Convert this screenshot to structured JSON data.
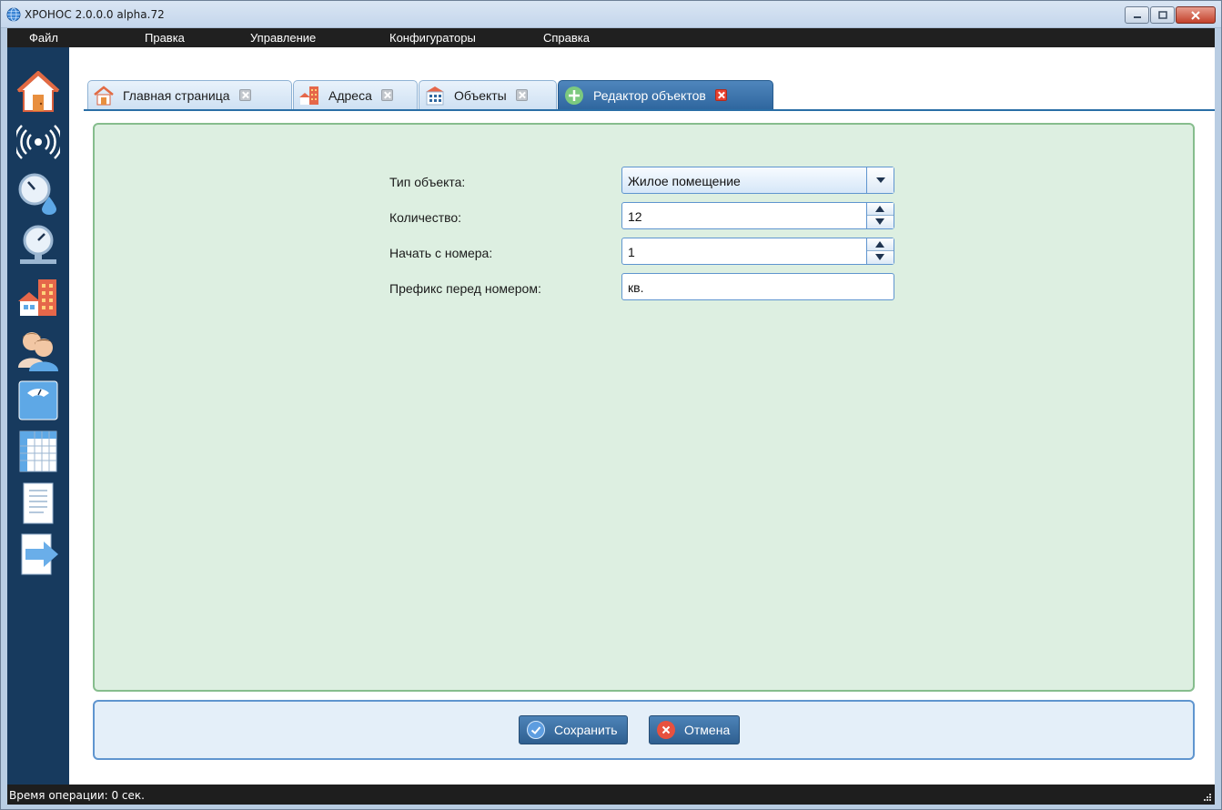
{
  "window": {
    "title": "ХРОНОС 2.0.0.0 alpha.72"
  },
  "menu": [
    "Файл",
    "Правка",
    "Управление",
    "Конфигураторы",
    "Справка"
  ],
  "tabs": [
    {
      "label": "Главная страница",
      "icon": "home-icon",
      "active": false
    },
    {
      "label": "Адреса",
      "icon": "buildings-icon",
      "active": false
    },
    {
      "label": "Объекты",
      "icon": "building-grid-icon",
      "active": false
    },
    {
      "label": "Редактор объектов",
      "icon": "add-circle-icon",
      "active": true
    }
  ],
  "sidebar": {
    "icons": [
      "home-door-icon",
      "signal-icon",
      "meter-drop-icon",
      "gauge-pipe-icon",
      "buildings-icon",
      "users-icon",
      "scale-icon",
      "table-icon",
      "document-icon",
      "exit-arrow-icon"
    ]
  },
  "form": {
    "object_type_label": "Тип объекта:",
    "object_type_value": "Жилое помещение",
    "quantity_label": "Количество:",
    "quantity_value": "12",
    "start_number_label": "Начать с номера:",
    "start_number_value": "1",
    "prefix_label": "Префикс перед номером:",
    "prefix_value": "кв."
  },
  "buttons": {
    "save_label": "Сохранить",
    "cancel_label": "Отмена"
  },
  "status": {
    "text": "Время операции: 0 сек."
  },
  "colors": {
    "sidebar_bg": "#173a5e",
    "form_panel_bg": "#ddefe1",
    "form_panel_border": "#86bd8d",
    "accent": "#2f679f",
    "close_red": "#e8412f"
  }
}
